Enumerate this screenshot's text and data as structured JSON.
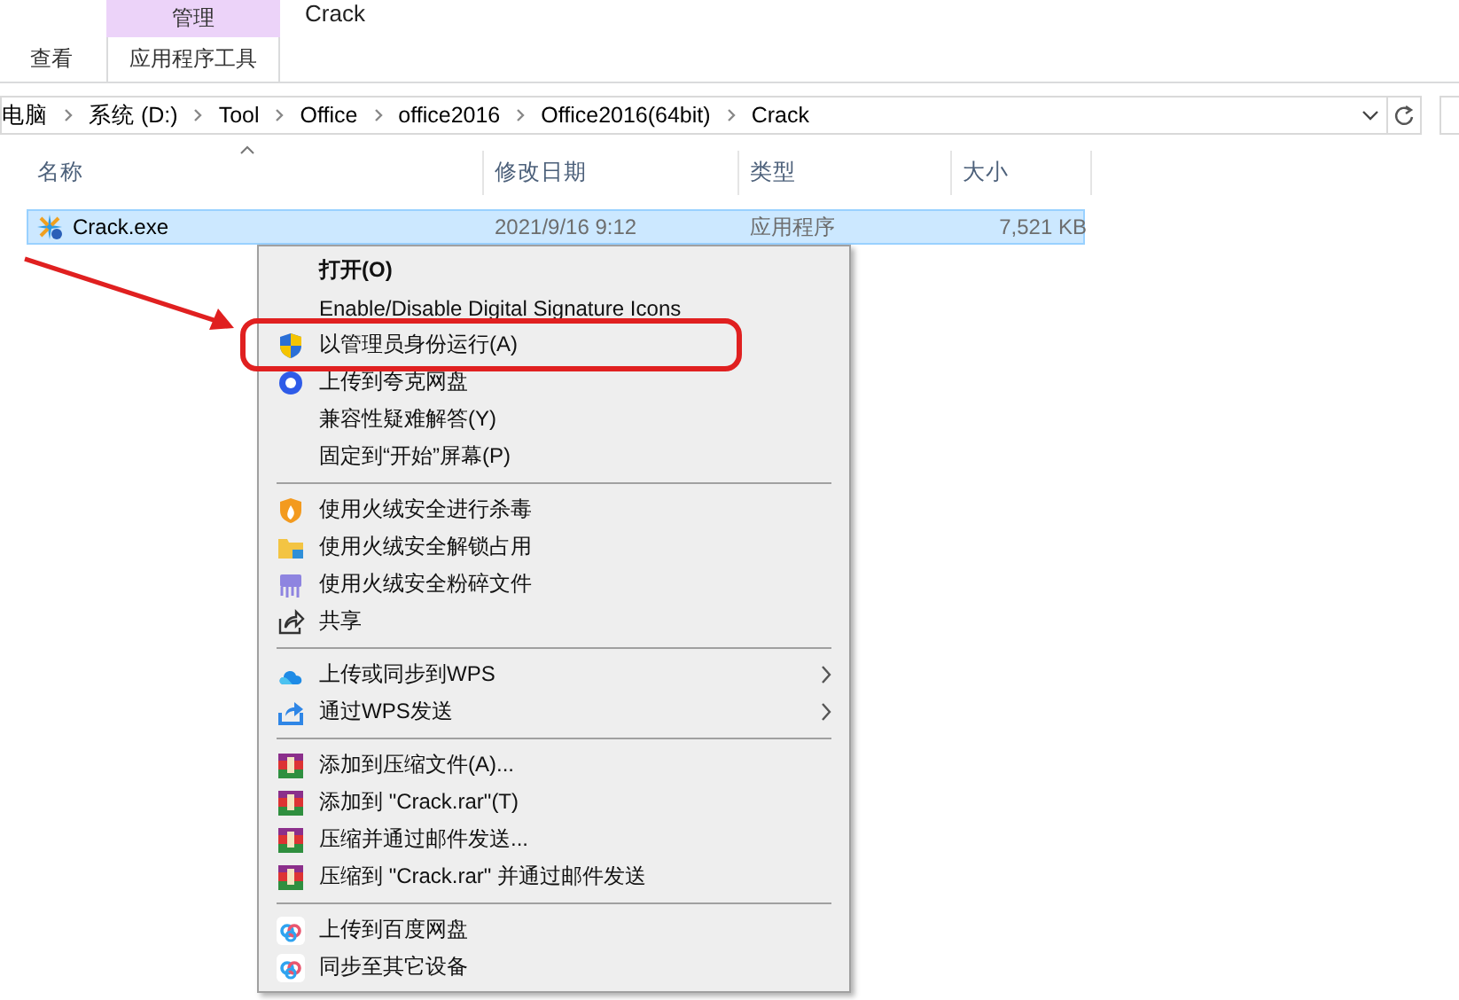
{
  "ribbon": {
    "context_group": "管理",
    "window_title": "Crack",
    "tabs": [
      {
        "label": "查看",
        "kind": "plain"
      },
      {
        "label": "应用程序工具",
        "kind": "contextual"
      }
    ]
  },
  "address_bar": {
    "crumbs": [
      "电脑",
      "系统 (D:)",
      "Tool",
      "Office",
      "office2016",
      "Office2016(64bit)",
      "Crack"
    ]
  },
  "columns": [
    {
      "label": "名称",
      "sorted": true
    },
    {
      "label": "修改日期",
      "sorted": false
    },
    {
      "label": "类型",
      "sorted": false
    },
    {
      "label": "大小",
      "sorted": false
    }
  ],
  "files": [
    {
      "name": "Crack.exe",
      "modified": "2021/9/16 9:12",
      "type": "应用程序",
      "size": "7,521 KB",
      "selected": true
    }
  ],
  "context_menu": {
    "items": [
      {
        "kind": "item",
        "label": "打开(O)",
        "default": true,
        "submenu": false
      },
      {
        "kind": "item",
        "label": "Enable/Disable Digital Signature Icons",
        "default": false,
        "submenu": false
      },
      {
        "kind": "item",
        "label": "以管理员身份运行(A)",
        "default": false,
        "submenu": false
      },
      {
        "kind": "item",
        "label": "上传到夸克网盘",
        "default": false,
        "submenu": false
      },
      {
        "kind": "item",
        "label": "兼容性疑难解答(Y)",
        "default": false,
        "submenu": false
      },
      {
        "kind": "item",
        "label": "固定到“开始”屏幕(P)",
        "default": false,
        "submenu": false
      },
      {
        "kind": "separator"
      },
      {
        "kind": "item",
        "label": "使用火绒安全进行杀毒",
        "default": false,
        "submenu": false
      },
      {
        "kind": "item",
        "label": "使用火绒安全解锁占用",
        "default": false,
        "submenu": false
      },
      {
        "kind": "item",
        "label": "使用火绒安全粉碎文件",
        "default": false,
        "submenu": false
      },
      {
        "kind": "item",
        "label": "共享",
        "default": false,
        "submenu": false
      },
      {
        "kind": "separator"
      },
      {
        "kind": "item",
        "label": "上传或同步到WPS",
        "default": false,
        "submenu": true
      },
      {
        "kind": "item",
        "label": "通过WPS发送",
        "default": false,
        "submenu": true
      },
      {
        "kind": "separator"
      },
      {
        "kind": "item",
        "label": "添加到压缩文件(A)...",
        "default": false,
        "submenu": false
      },
      {
        "kind": "item",
        "label": "添加到 \"Crack.rar\"(T)",
        "default": false,
        "submenu": false
      },
      {
        "kind": "item",
        "label": "压缩并通过邮件发送...",
        "default": false,
        "submenu": false
      },
      {
        "kind": "item",
        "label": "压缩到 \"Crack.rar\" 并通过邮件发送",
        "default": false,
        "submenu": false
      },
      {
        "kind": "separator"
      },
      {
        "kind": "item",
        "label": "上传到百度网盘",
        "default": false,
        "submenu": false
      },
      {
        "kind": "item",
        "label": "同步至其它设备",
        "default": false,
        "submenu": false
      }
    ]
  }
}
